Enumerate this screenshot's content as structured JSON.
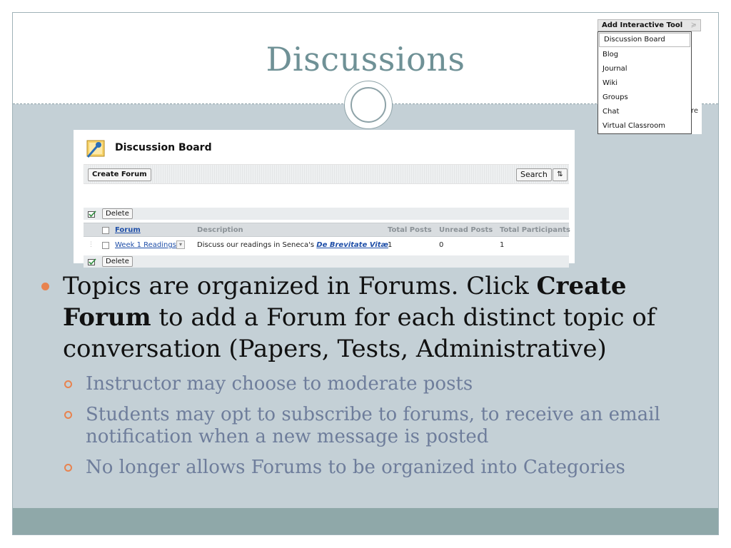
{
  "slide": {
    "title": "Discussions"
  },
  "panel": {
    "title": "Discussion Board",
    "toolbar": {
      "create_label": "Create Forum",
      "search_label": "Search",
      "sort_icon": "⇅"
    },
    "actions": {
      "delete_label": "Delete"
    },
    "table": {
      "columns": [
        "Forum",
        "Description",
        "Total Posts",
        "Unread Posts",
        "Total Participants"
      ],
      "rows": [
        {
          "forum": "Week 1 Readings",
          "description_prefix": "Discuss our readings in Seneca's ",
          "description_link": "De Brevitate Vitæ",
          "total_posts": "1",
          "unread_posts": "0",
          "total_participants": "1"
        }
      ]
    }
  },
  "dropdown": {
    "header": "Add Interactive Tool",
    "items": [
      "Discussion Board",
      "Blog",
      "Journal",
      "Wiki",
      "Groups",
      "Chat",
      "Virtual Classroom"
    ],
    "selected": "Discussion Board",
    "peek_text": "re"
  },
  "bullets": {
    "main": {
      "part1": "Topics are organized in Forums. Click ",
      "bold1": "Create Forum",
      "part2": " to add a Forum for each distinct topic of conversation (Papers, Tests, Administrative)"
    },
    "sub": [
      "Instructor may choose to moderate posts",
      "Students may opt to subscribe to forums, to receive an email notification when a new message is posted",
      "No longer allows Forums to be organized into Categories"
    ]
  },
  "colors": {
    "title": "#6f9196",
    "bullet_accent": "#e8834f",
    "sub_text": "#6e7d9b",
    "slide_bg": "#c4d0d6",
    "footer": "#8fa8a9",
    "link": "#1f4fa8"
  },
  "icons": {
    "board_icon": "pushpin-board-icon",
    "chevron": "chevron-down-icon",
    "check_all": "check-all-icon"
  }
}
